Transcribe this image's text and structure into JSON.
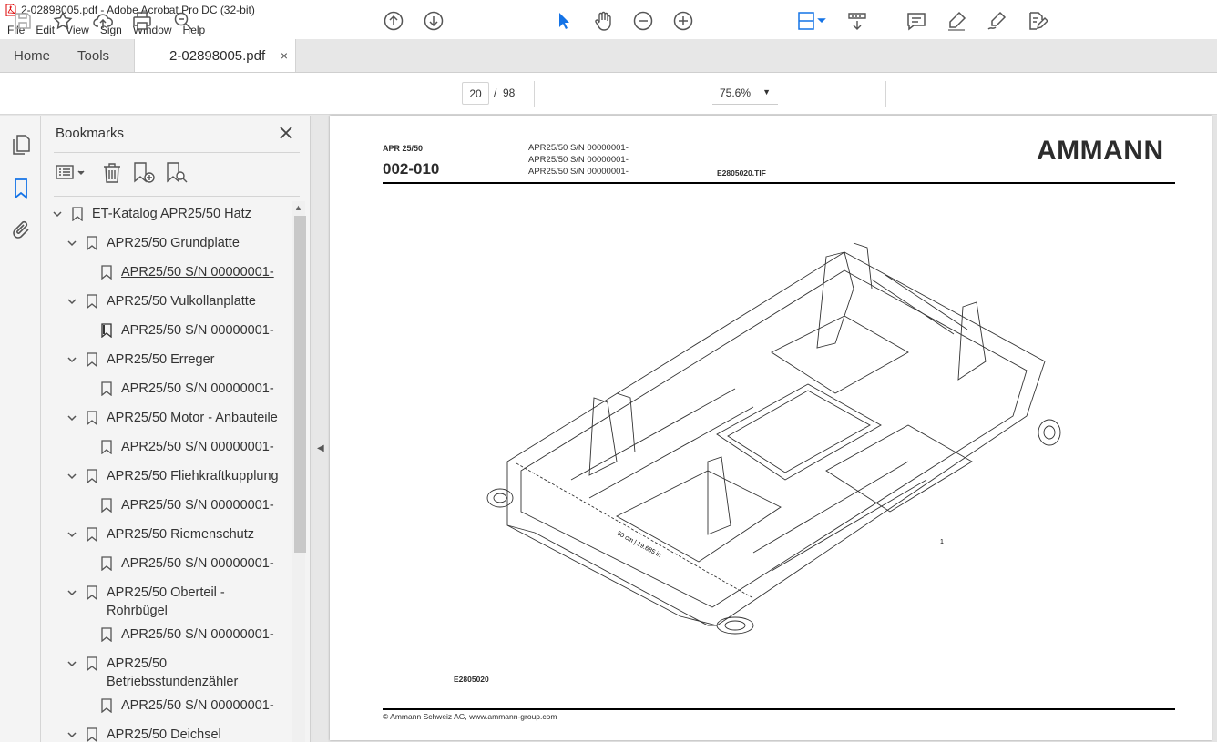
{
  "window": {
    "title": "2-02898005.pdf - Adobe Acrobat Pro DC (32-bit)"
  },
  "menu": [
    "File",
    "Edit",
    "View",
    "Sign",
    "Window",
    "Help"
  ],
  "tabs": {
    "home": "Home",
    "tools": "Tools",
    "document": "2-02898005.pdf",
    "close": "×"
  },
  "toolbar": {
    "page_current": "20",
    "page_sep": "/",
    "page_total": "98",
    "zoom": "75.6%"
  },
  "bookmarks": {
    "title": "Bookmarks",
    "items": [
      {
        "label": "ET-Katalog APR25/50 Hatz"
      },
      {
        "label": "APR25/50 Grundplatte"
      },
      {
        "label": "APR25/50 S/N 00000001-"
      },
      {
        "label": "APR25/50 Vulkollanplatte"
      },
      {
        "label": "APR25/50 S/N 00000001-"
      },
      {
        "label": "APR25/50 Erreger"
      },
      {
        "label": "APR25/50 S/N 00000001-"
      },
      {
        "label": "APR25/50 Motor - Anbauteile"
      },
      {
        "label": "APR25/50 S/N 00000001-"
      },
      {
        "label": "APR25/50 Fliehkraftkupplung"
      },
      {
        "label": "APR25/50 S/N 00000001-"
      },
      {
        "label": "APR25/50 Riemenschutz"
      },
      {
        "label": "APR25/50 S/N 00000001-"
      },
      {
        "label": "APR25/50 Oberteil -"
      },
      {
        "label": "Rohrbügel"
      },
      {
        "label": "APR25/50 S/N 00000001-"
      },
      {
        "label": "APR25/50"
      },
      {
        "label": "Betriebsstundenzähler"
      },
      {
        "label": "APR25/50 S/N 00000001-"
      },
      {
        "label": "APR25/50 Deichsel"
      }
    ]
  },
  "page": {
    "model": "APR 25/50",
    "number": "002-010",
    "sn_lines": [
      "APR25/50 S/N 00000001-",
      "APR25/50 S/N 00000001-",
      "APR25/50 S/N 00000001-"
    ],
    "tif": "E2805020.TIF",
    "logo": "AMMANN",
    "drawing_code": "E2805020",
    "dimension": "50 cm | 19.685 in",
    "callout": "1",
    "copyright": "© Ammann Schweiz AG, www.ammann-group.com"
  },
  "colors": {
    "accent": "#1473e6",
    "text": "#2c2c2c",
    "panel": "#f4f4f4"
  }
}
